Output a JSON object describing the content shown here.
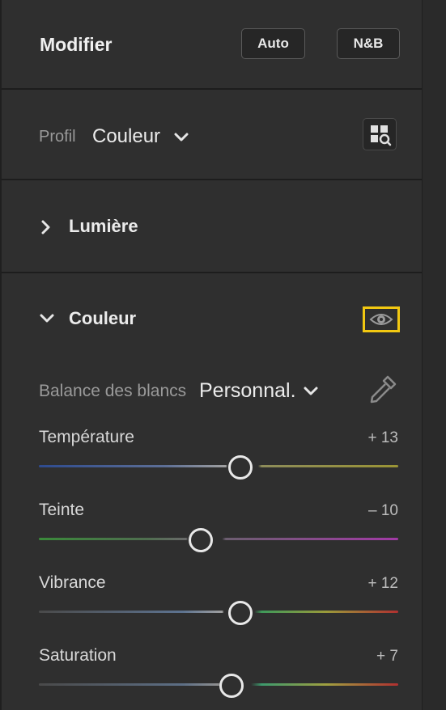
{
  "header": {
    "title": "Modifier",
    "auto_label": "Auto",
    "nb_label": "N&B"
  },
  "profil": {
    "label": "Profil",
    "value": "Couleur",
    "browse_icon": "profile-browser-icon"
  },
  "sections": {
    "lumiere": "Lumière",
    "couleur": "Couleur"
  },
  "accent": {
    "highlight": "#f2c811"
  },
  "white_balance": {
    "label": "Balance des blancs",
    "value": "Personnal."
  },
  "sliders": [
    {
      "label": "Température",
      "value": "+ 13",
      "level": 0.56
    },
    {
      "label": "Teinte",
      "value": "– 10",
      "level": 0.45
    },
    {
      "label": "Vibrance",
      "value": "+ 12",
      "level": 0.56
    },
    {
      "label": "Saturation",
      "value": "+ 7",
      "level": 0.535
    }
  ]
}
